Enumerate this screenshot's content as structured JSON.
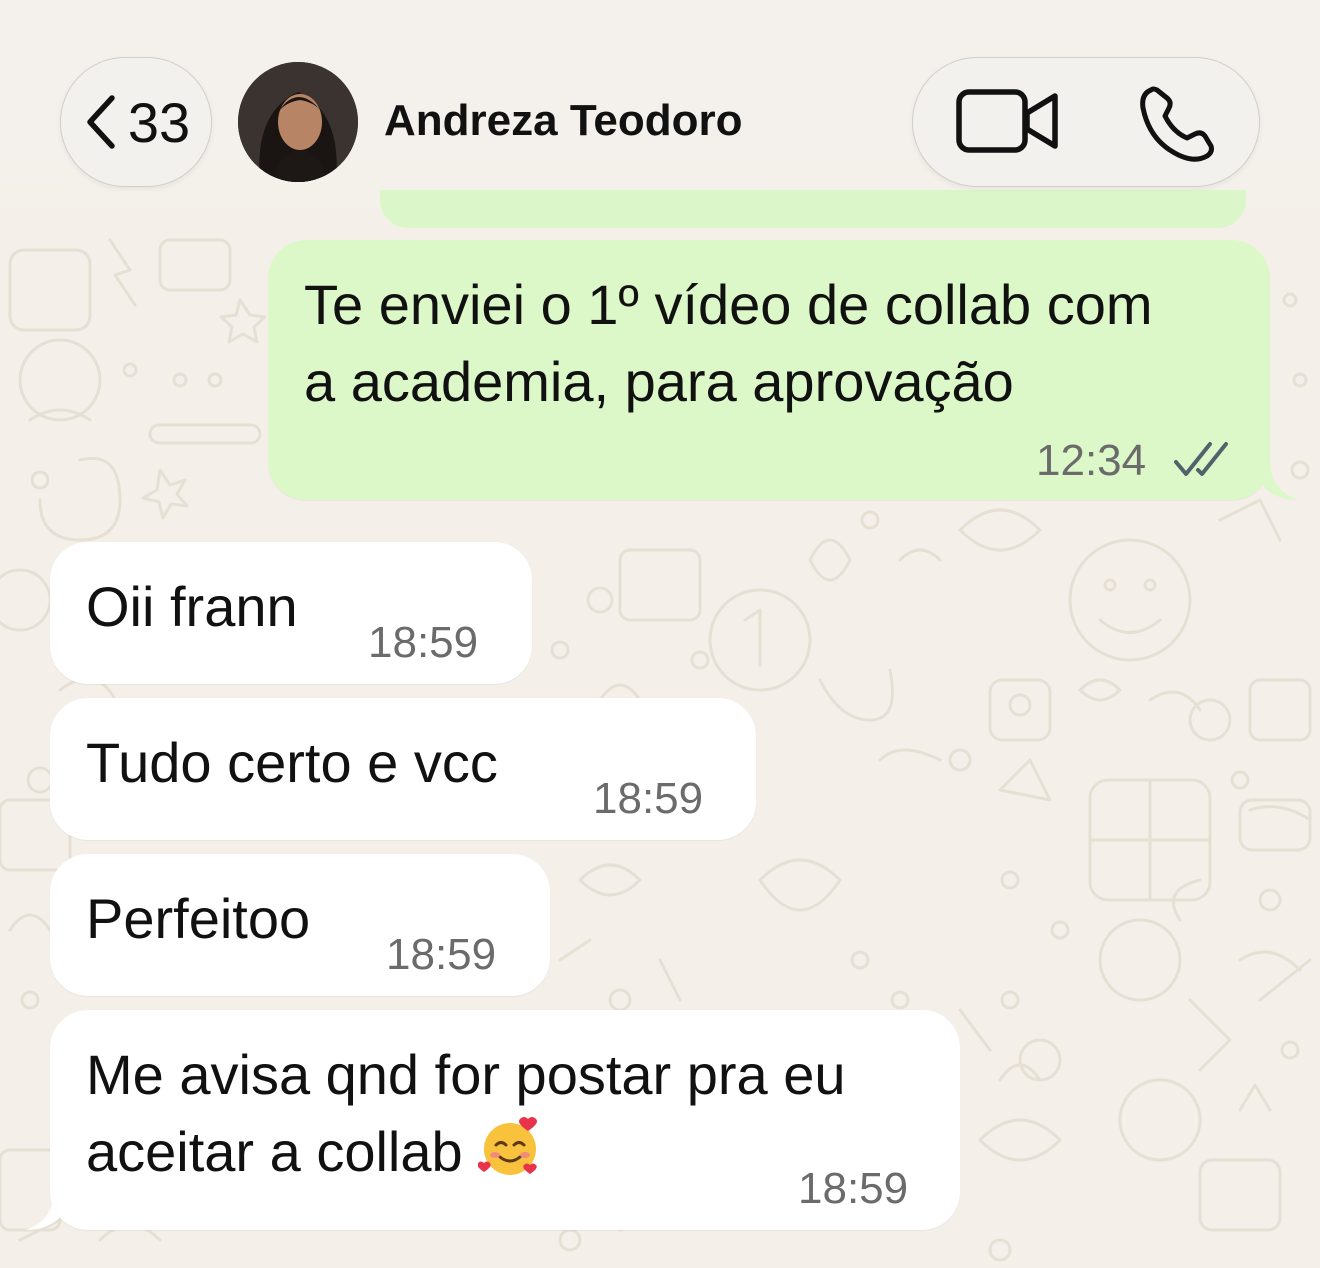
{
  "header": {
    "back_count": "33",
    "contact_name": "Andreza Teodoro",
    "icons": {
      "back": "chevron-left-icon",
      "video": "video-call-icon",
      "phone": "phone-call-icon"
    }
  },
  "messages": [
    {
      "direction": "outgoing",
      "lines": [
        "Te enviei o 1º vídeo de collab com",
        "a academia, para aprovação"
      ],
      "time": "12:34",
      "status": "read"
    },
    {
      "direction": "incoming",
      "text": "Oii frann",
      "time": "18:59"
    },
    {
      "direction": "incoming",
      "text": "Tudo certo e vcc",
      "time": "18:59"
    },
    {
      "direction": "incoming",
      "text": "Perfeitoo",
      "time": "18:59"
    },
    {
      "direction": "incoming",
      "lines": [
        "Me avisa qnd for postar pra eu",
        "aceitar a collab"
      ],
      "emoji": "smiling-face-with-hearts",
      "time": "18:59"
    }
  ],
  "colors": {
    "wallpaper": "#f4f0e9",
    "outgoing_bubble": "#dcf8c8",
    "incoming_bubble": "#ffffff",
    "read_check": "#53616b"
  }
}
